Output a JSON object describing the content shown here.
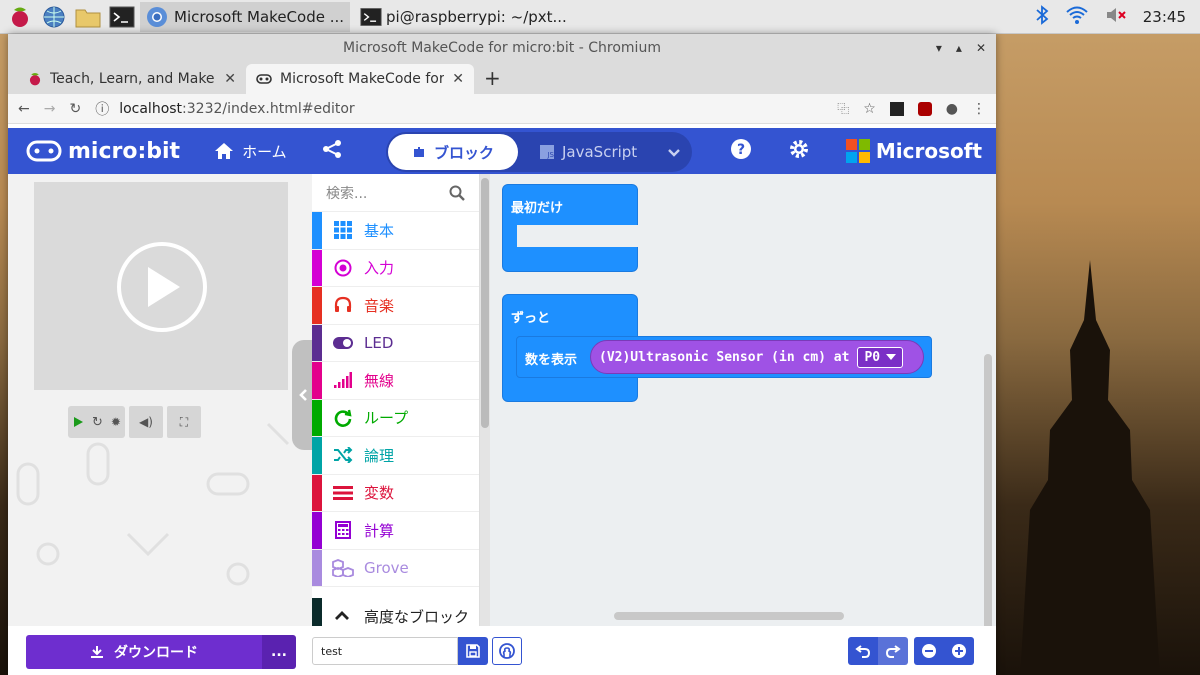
{
  "taskbar": {
    "tasks": [
      {
        "label": "Microsoft MakeCode ..."
      },
      {
        "label": "pi@raspberrypi: ~/pxt..."
      }
    ],
    "clock": "23:45"
  },
  "window": {
    "title": "Microsoft MakeCode for micro:bit - Chromium"
  },
  "tabs": [
    {
      "label": "Teach, Learn, and Make w"
    },
    {
      "label": "Microsoft MakeCode for m"
    }
  ],
  "address": {
    "host": "localhost",
    "rest": ":3232/index.html#editor"
  },
  "header": {
    "logo": "micro:bit",
    "home": "ホーム",
    "blocks": "ブロック",
    "javascript": "JavaScript",
    "microsoft": "Microsoft"
  },
  "toolbox": {
    "search_placeholder": "検索...",
    "categories": [
      {
        "label": "基本",
        "color": "#1e90ff"
      },
      {
        "label": "入力",
        "color": "#d400d4"
      },
      {
        "label": "音楽",
        "color": "#e63022"
      },
      {
        "label": "LED",
        "color": "#5c2d91"
      },
      {
        "label": "無線",
        "color": "#e3008c"
      },
      {
        "label": "ループ",
        "color": "#00aa00"
      },
      {
        "label": "論理",
        "color": "#00a4a6"
      },
      {
        "label": "変数",
        "color": "#dc143c"
      },
      {
        "label": "計算",
        "color": "#9400d3"
      },
      {
        "label": "Grove",
        "color": "#a98bdf"
      }
    ],
    "advanced": "高度なブロック"
  },
  "workspace": {
    "on_start": "最初だけ",
    "forever": "ずっと",
    "show_number": "数を表示",
    "reporter": "(V2)Ultrasonic Sensor (in cm) at",
    "pin": "P0"
  },
  "bottom": {
    "download": "ダウンロード",
    "more": "...",
    "project_name": "test"
  }
}
